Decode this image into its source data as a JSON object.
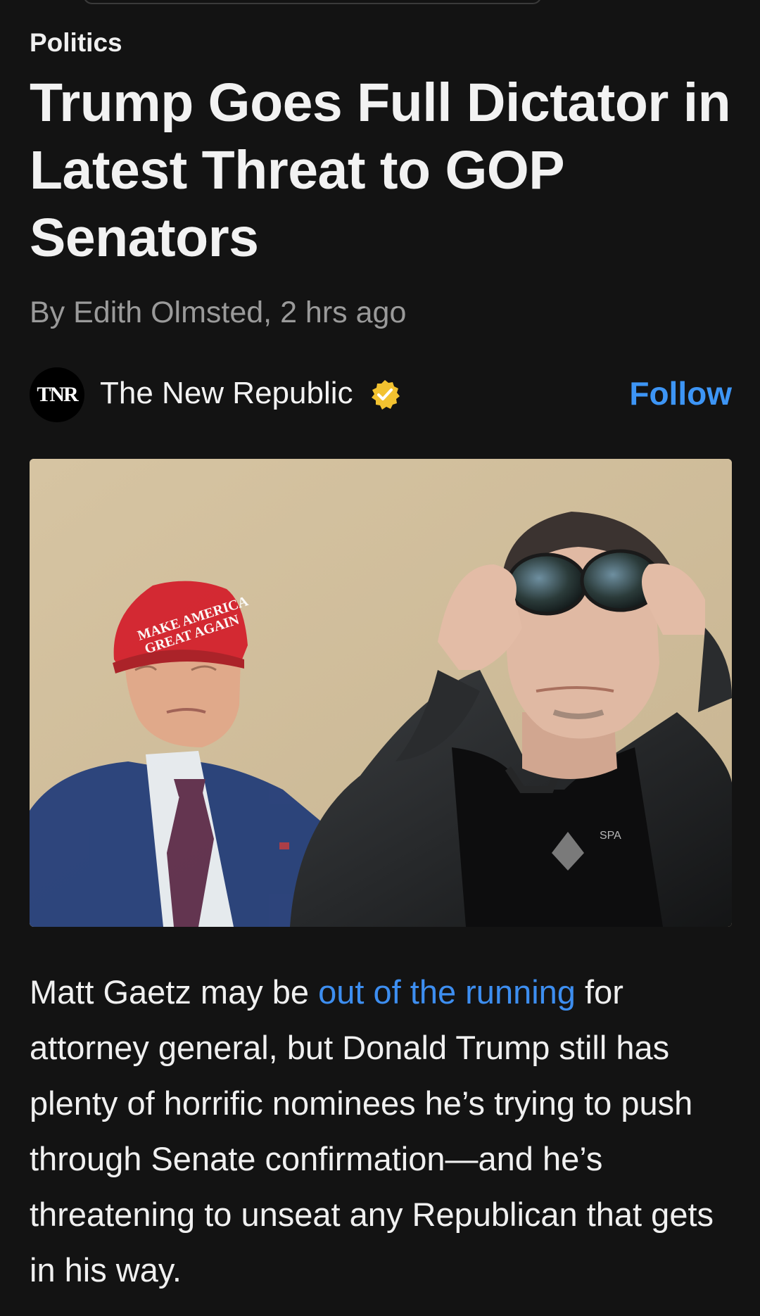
{
  "article": {
    "category": "Politics",
    "headline": "Trump Goes Full Dictator in Latest Threat to GOP Senators",
    "byline": "By Edith Olmsted, 2 hrs ago",
    "image_alt": "Donald Trump in a red MAGA hat beside Elon Musk adjusting sunglasses",
    "image_cap_text_line1": "MAKE AMERICA",
    "image_cap_text_line2": "GREAT AGAIN",
    "image_shirt_text": "SPA",
    "body": {
      "text_before_link": "Matt Gaetz may be ",
      "link_text": "out of the running",
      "text_after_link": " for attorney general, but Donald Trump still has plenty of horrific nominees he’s trying to push through Senate confirmation—and he’s threatening to unseat any Republican that gets in his way."
    }
  },
  "publisher": {
    "logo_text": "TNR",
    "name": "The New Republic",
    "verified_icon": "verified-badge-icon",
    "follow_label": "Follow"
  },
  "colors": {
    "background": "#131313",
    "accent_link": "#3d8ef0",
    "follow": "#3d95f5",
    "verified": "#f2c230",
    "byline": "#9a9a9a"
  }
}
